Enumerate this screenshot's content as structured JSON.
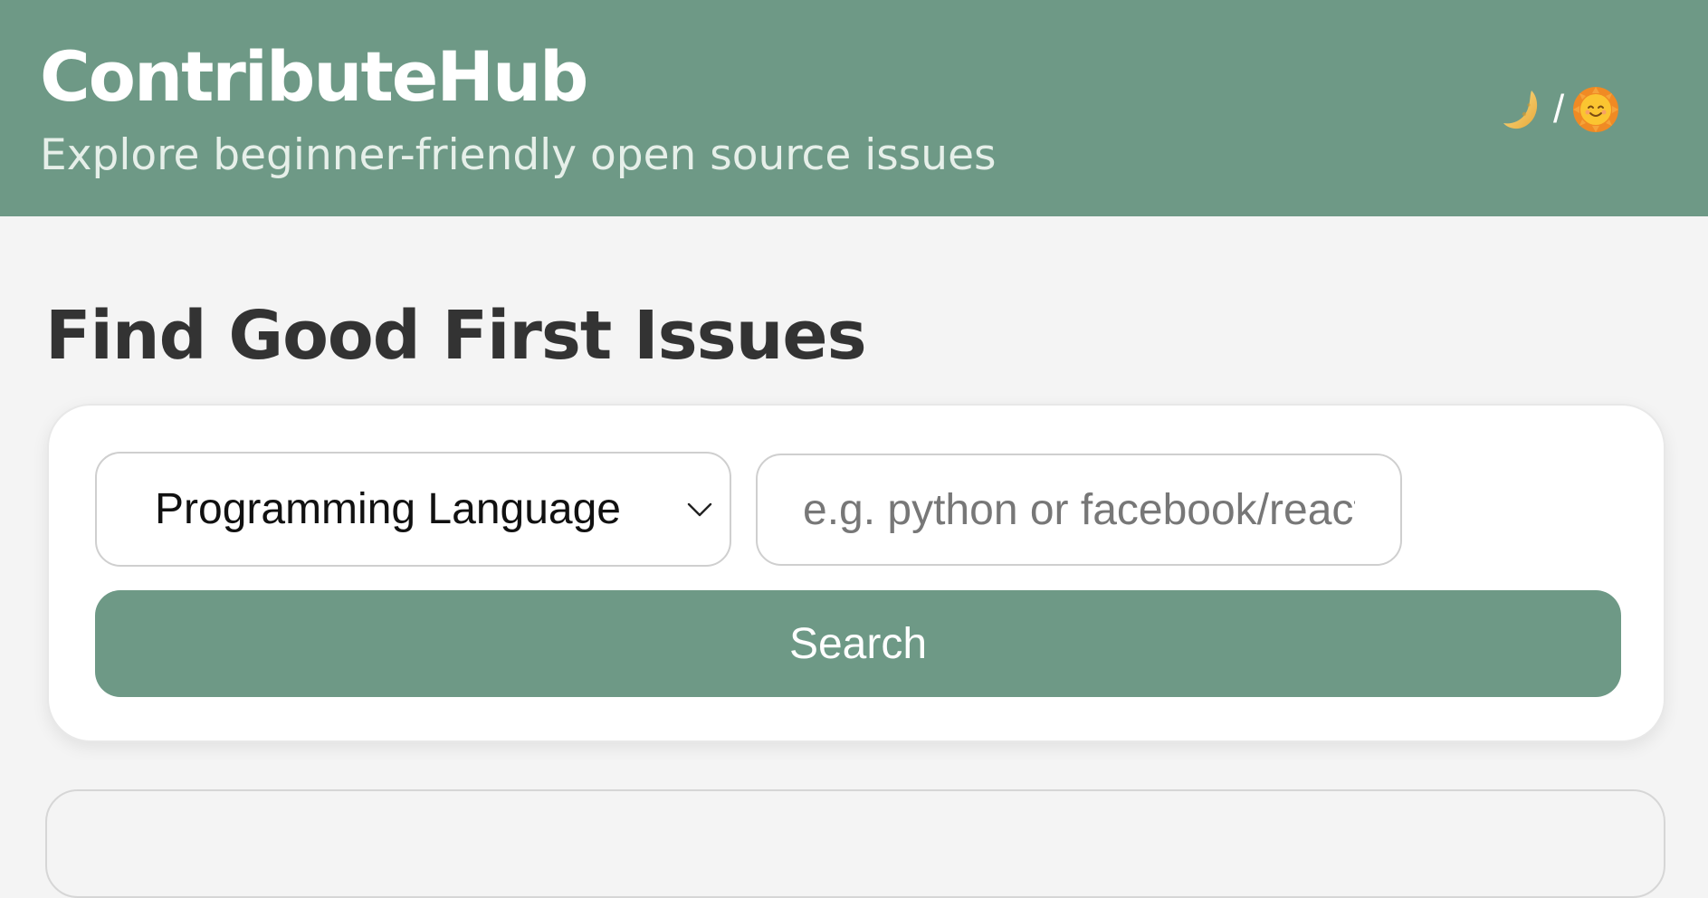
{
  "header": {
    "title": "ContributeHub",
    "subtitle": "Explore beginner-friendly open source issues",
    "theme_toggle": {
      "dark_icon": "moon-icon",
      "separator": "/",
      "light_icon": "sun-icon"
    }
  },
  "main": {
    "section_title": "Find Good First Issues",
    "search": {
      "filter_select_value": "Programming Language",
      "query_placeholder": "e.g. python or facebook/react",
      "query_value": "",
      "button_label": "Search"
    }
  },
  "colors": {
    "accent": "#6e9986",
    "background": "#f4f4f4",
    "card": "#ffffff",
    "heading_text": "#333333"
  }
}
